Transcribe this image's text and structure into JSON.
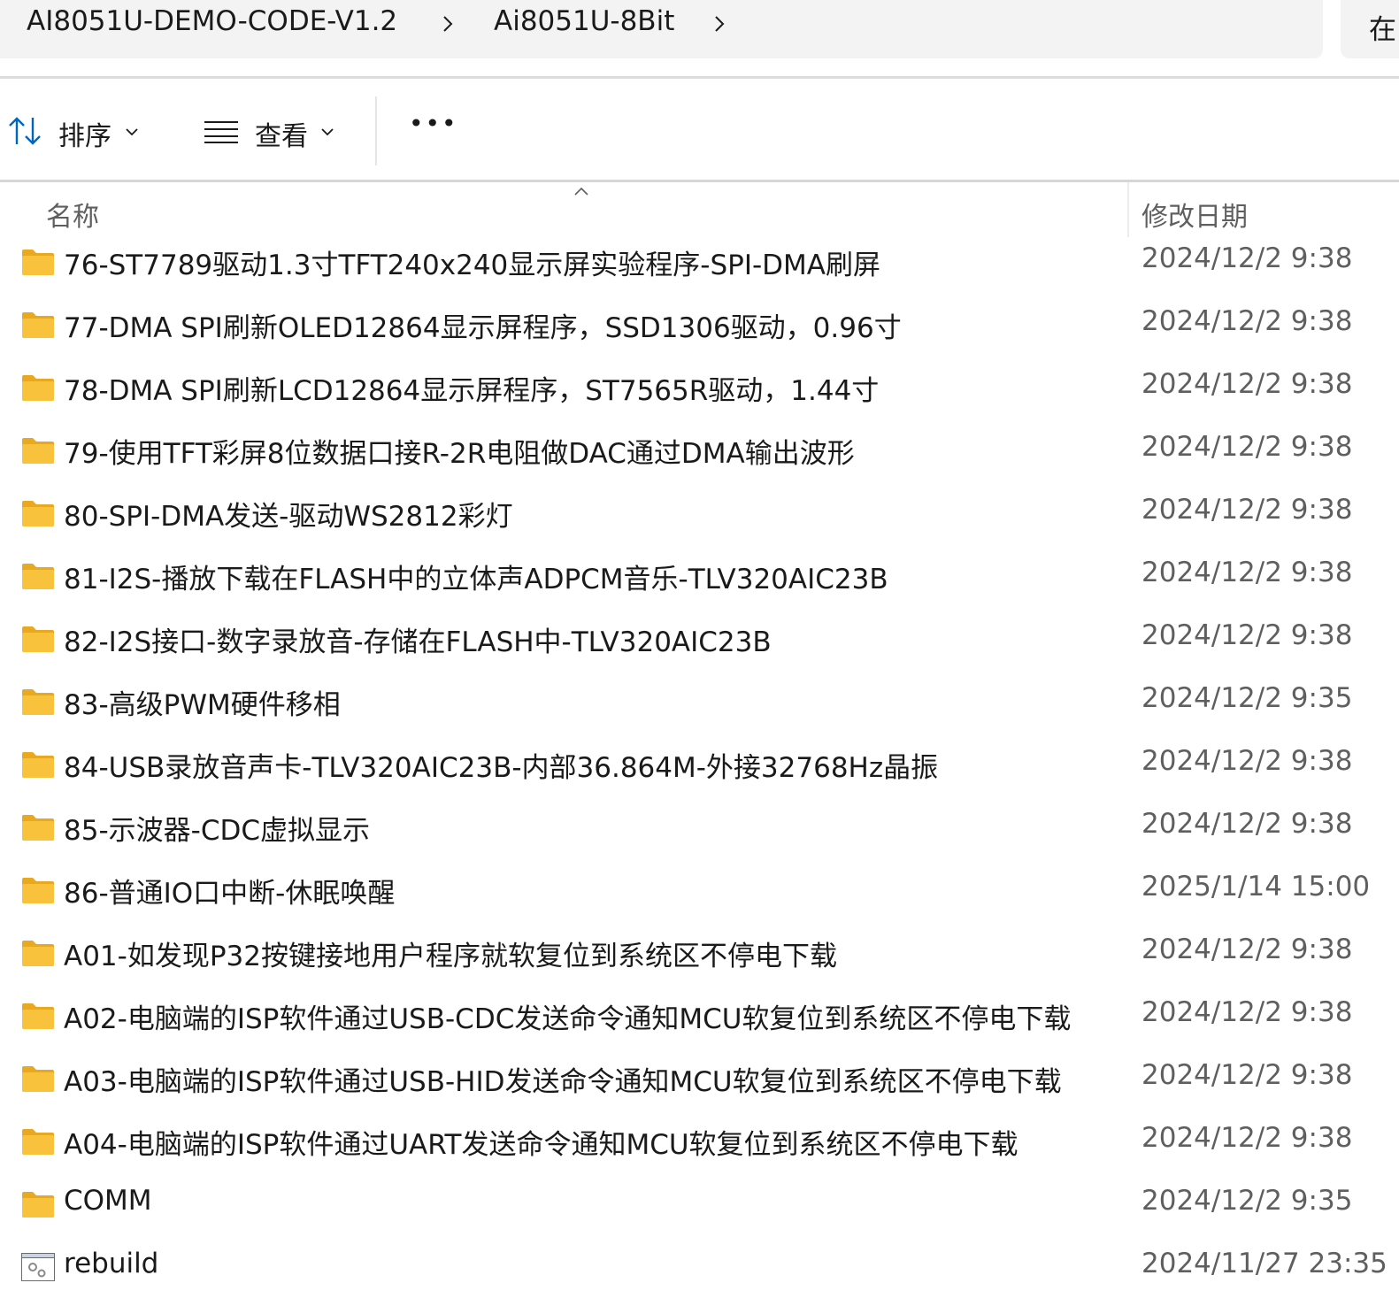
{
  "breadcrumb": {
    "items": [
      "AI8051U-DEMO-CODE-V1.2",
      "Ai8051U-8Bit"
    ]
  },
  "search": {
    "label_partial": "在"
  },
  "toolbar": {
    "sort_label": "排序",
    "view_label": "查看",
    "more_label": "•••"
  },
  "columns": {
    "name": "名称",
    "date": "修改日期"
  },
  "colors": {
    "folder": "#f9c23c",
    "folder_back": "#e8a820",
    "accent": "#0067c0"
  },
  "files": [
    {
      "name": "76-ST7789驱动1.3寸TFT240x240显示屏实验程序-SPI-DMA刷屏",
      "date": "2024/12/2 9:38",
      "icon": "folder-icon"
    },
    {
      "name": "77-DMA SPI刷新OLED12864显示屏程序，SSD1306驱动，0.96寸",
      "date": "2024/12/2 9:38",
      "icon": "folder-icon"
    },
    {
      "name": "78-DMA SPI刷新LCD12864显示屏程序，ST7565R驱动，1.44寸",
      "date": "2024/12/2 9:38",
      "icon": "folder-icon"
    },
    {
      "name": "79-使用TFT彩屏8位数据口接R-2R电阻做DAC通过DMA输出波形",
      "date": "2024/12/2 9:38",
      "icon": "folder-icon"
    },
    {
      "name": "80-SPI-DMA发送-驱动WS2812彩灯",
      "date": "2024/12/2 9:38",
      "icon": "folder-icon"
    },
    {
      "name": "81-I2S-播放下载在FLASH中的立体声ADPCM音乐-TLV320AIC23B",
      "date": "2024/12/2 9:38",
      "icon": "folder-icon"
    },
    {
      "name": "82-I2S接口-数字录放音-存储在FLASH中-TLV320AIC23B",
      "date": "2024/12/2 9:38",
      "icon": "folder-icon"
    },
    {
      "name": "83-高级PWM硬件移相",
      "date": "2024/12/2 9:35",
      "icon": "folder-icon"
    },
    {
      "name": "84-USB录放音声卡-TLV320AIC23B-内部36.864M-外接32768Hz晶振",
      "date": "2024/12/2 9:38",
      "icon": "folder-icon"
    },
    {
      "name": "85-示波器-CDC虚拟显示",
      "date": "2024/12/2 9:38",
      "icon": "folder-icon"
    },
    {
      "name": "86-普通IO口中断-休眠唤醒",
      "date": "2025/1/14 15:00",
      "icon": "folder-icon"
    },
    {
      "name": "A01-如发现P32按键接地用户程序就软复位到系统区不停电下载",
      "date": "2024/12/2 9:38",
      "icon": "folder-icon"
    },
    {
      "name": "A02-电脑端的ISP软件通过USB-CDC发送命令通知MCU软复位到系统区不停电下载",
      "date": "2024/12/2 9:38",
      "icon": "folder-icon"
    },
    {
      "name": "A03-电脑端的ISP软件通过USB-HID发送命令通知MCU软复位到系统区不停电下载",
      "date": "2024/12/2 9:38",
      "icon": "folder-icon"
    },
    {
      "name": "A04-电脑端的ISP软件通过UART发送命令通知MCU软复位到系统区不停电下载",
      "date": "2024/12/2 9:38",
      "icon": "folder-icon"
    },
    {
      "name": "COMM",
      "date": "2024/12/2 9:35",
      "icon": "folder-icon"
    },
    {
      "name": "rebuild",
      "date": "2024/11/27 23:35",
      "icon": "batch-file-icon"
    }
  ]
}
